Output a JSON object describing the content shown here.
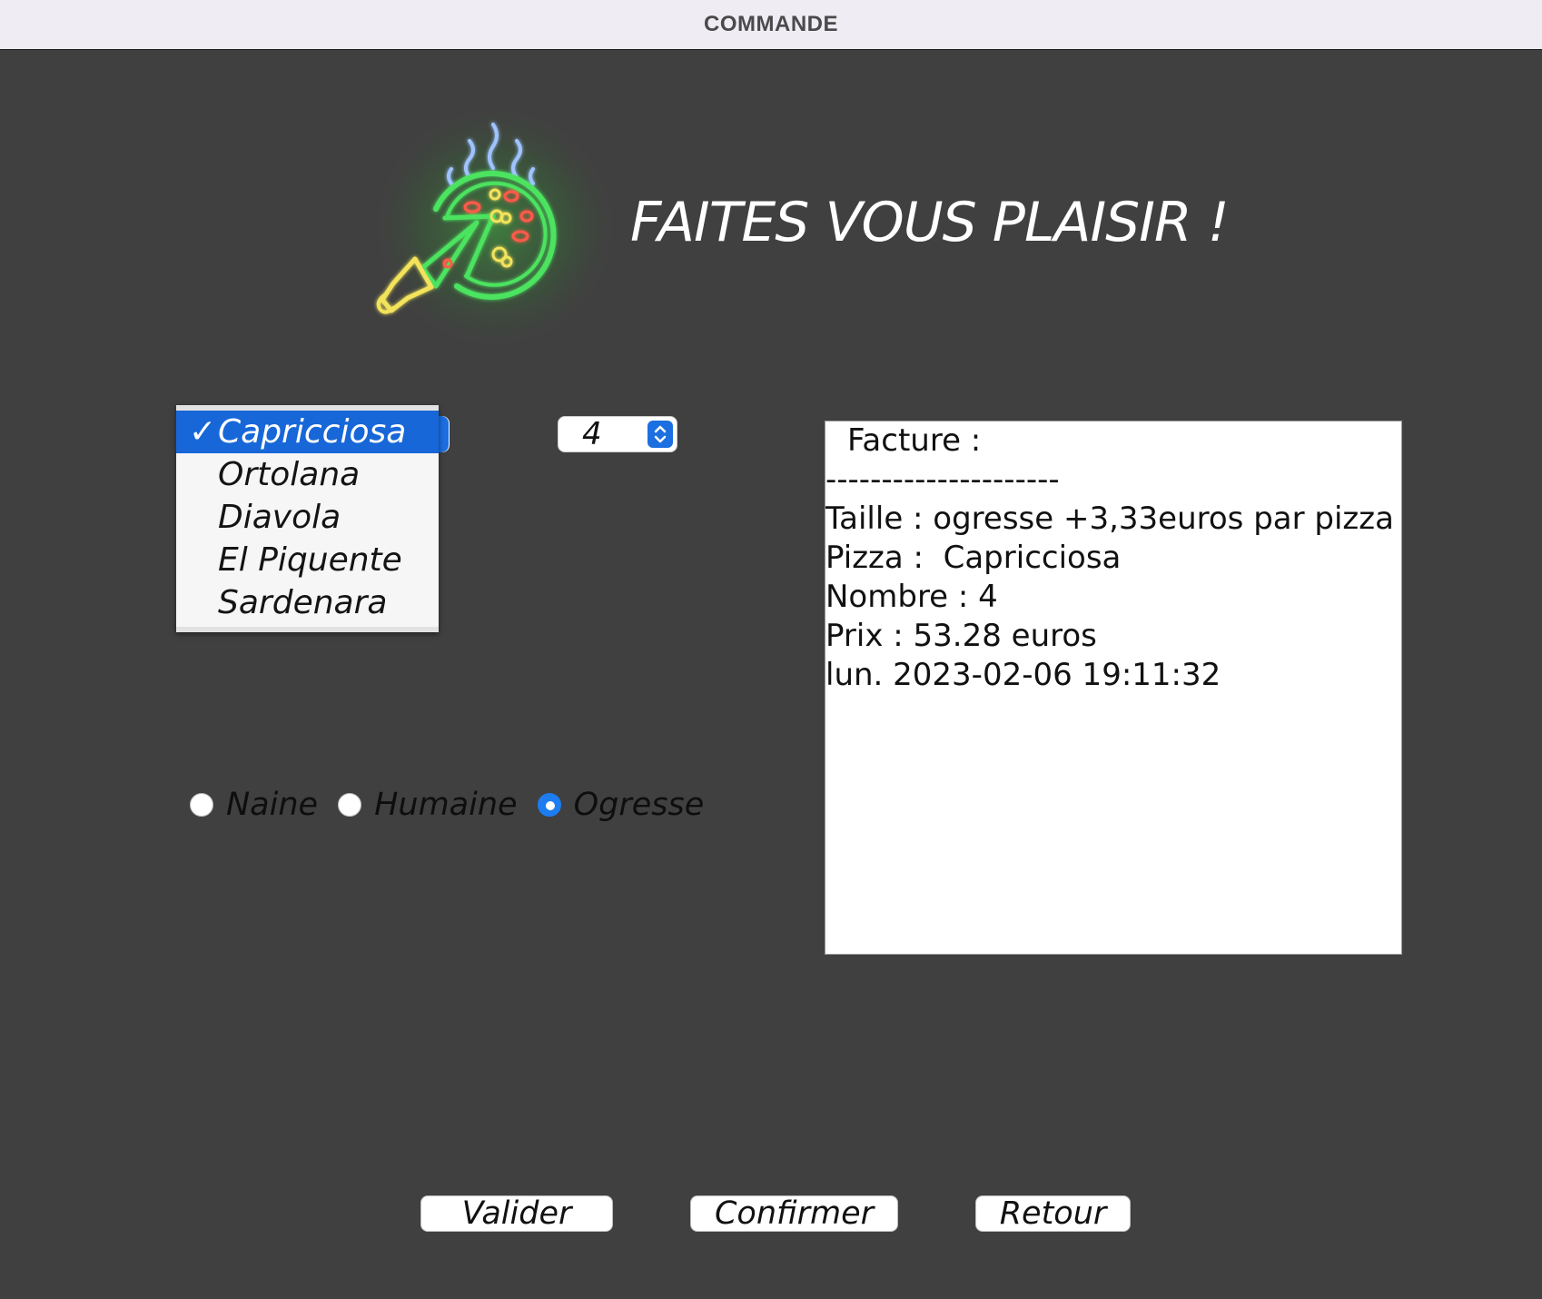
{
  "window": {
    "title": "COMMANDE"
  },
  "header": {
    "headline": "FAITES VOUS PLAISIR !",
    "logo_icon": "neon-pizza-icon"
  },
  "pizza_select": {
    "selected": "Capricciosa",
    "check_mark": "✓",
    "options": [
      "Capricciosa",
      "Ortolana",
      "Diavola",
      "El Piquente",
      "Sardenara"
    ]
  },
  "quantity": {
    "value": "4"
  },
  "size": {
    "options": [
      {
        "label": "Naine",
        "checked": false
      },
      {
        "label": "Humaine",
        "checked": false
      },
      {
        "label": "Ogresse",
        "checked": true
      }
    ]
  },
  "invoice": {
    "lines": [
      "Facture :",
      "---------------------",
      "Taille : ogresse +3,33euros par pizza",
      "Pizza :  Capricciosa",
      "Nombre : 4",
      "Prix : 53.28 euros",
      "lun. 2023-02-06 19:11:32"
    ]
  },
  "buttons": {
    "valider": "Valider",
    "confirmer": "Confirmer",
    "retour": "Retour"
  },
  "colors": {
    "background": "#404040",
    "accent": "#1c6fe0",
    "neon_green": "#39d353",
    "neon_yellow": "#f2e35a",
    "neon_red": "#ff5a4a"
  }
}
